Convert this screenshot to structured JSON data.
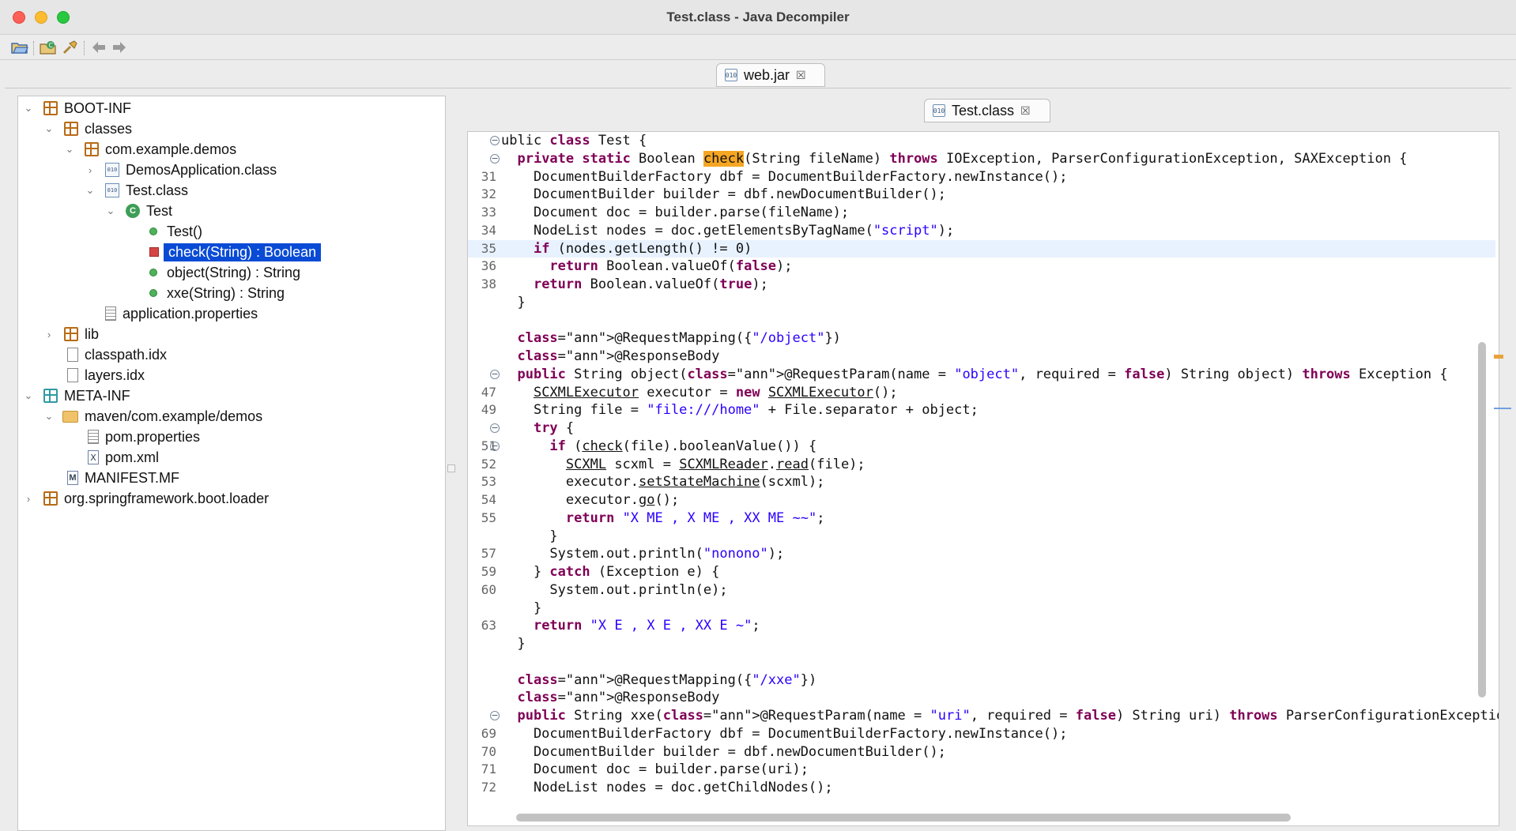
{
  "window": {
    "title": "Test.class - Java Decompiler",
    "colors": {
      "selection": "#0a4bd6",
      "keyword": "#7f0055",
      "string": "#2a00ff",
      "annotation": "#646464",
      "highlight": "#f5a623"
    }
  },
  "toolbar": {
    "icons": [
      "open-file-icon",
      "open-type-icon",
      "search-icon",
      "back-arrow-icon",
      "forward-arrow-icon"
    ]
  },
  "jar_tab": {
    "label": "web.jar",
    "close": "☒"
  },
  "class_tab": {
    "label": "Test.class",
    "close": "☒"
  },
  "tree": {
    "boot_inf": "BOOT-INF",
    "classes": "classes",
    "com_example_demos": "com.example.demos",
    "demos_application": "DemosApplication.class",
    "test_class": "Test.class",
    "test_type": "Test",
    "m_ctor": "Test()",
    "m_check": "check(String) : Boolean",
    "m_object": "object(String) : String",
    "m_xxe": "xxe(String) : String",
    "app_props": "application.properties",
    "lib": "lib",
    "classpath_idx": "classpath.idx",
    "layers_idx": "layers.idx",
    "meta_inf": "META-INF",
    "maven": "maven/com.example/demos",
    "pom_props": "pom.properties",
    "pom_xml": "pom.xml",
    "manifest": "MANIFEST.MF",
    "loader": "org.springframework.boot.loader"
  },
  "code": {
    "lines": [
      {
        "num": "",
        "fold": "⊖",
        "text": "ublic class Test {"
      },
      {
        "num": "",
        "fold": "⊖",
        "text": "  private static Boolean check(String fileName) throws IOException, ParserConfigurationException, SAXException {"
      },
      {
        "num": "31",
        "fold": "",
        "text": "    DocumentBuilderFactory dbf = DocumentBuilderFactory.newInstance();"
      },
      {
        "num": "32",
        "fold": "",
        "text": "    DocumentBuilder builder = dbf.newDocumentBuilder();"
      },
      {
        "num": "33",
        "fold": "",
        "text": "    Document doc = builder.parse(fileName);"
      },
      {
        "num": "34",
        "fold": "",
        "text": "    NodeList nodes = doc.getElementsByTagName(\"script\");"
      },
      {
        "num": "35",
        "fold": "",
        "text": "    if (nodes.getLength() != 0)"
      },
      {
        "num": "36",
        "fold": "",
        "text": "      return Boolean.valueOf(false);"
      },
      {
        "num": "38",
        "fold": "",
        "text": "    return Boolean.valueOf(true);"
      },
      {
        "num": "",
        "fold": "",
        "text": "  }"
      },
      {
        "num": "",
        "fold": "",
        "text": ""
      },
      {
        "num": "",
        "fold": "",
        "text": "  @RequestMapping({\"/object\"})"
      },
      {
        "num": "",
        "fold": "",
        "text": "  @ResponseBody"
      },
      {
        "num": "",
        "fold": "⊖",
        "text": "  public String object(@RequestParam(name = \"object\", required = false) String object) throws Exception {"
      },
      {
        "num": "47",
        "fold": "",
        "text": "    SCXMLExecutor executor = new SCXMLExecutor();"
      },
      {
        "num": "49",
        "fold": "",
        "text": "    String file = \"file:///home\" + File.separator + object;"
      },
      {
        "num": "",
        "fold": "⊖",
        "text": "    try {"
      },
      {
        "num": "51",
        "fold": "⊖",
        "text": "      if (check(file).booleanValue()) {"
      },
      {
        "num": "52",
        "fold": "",
        "text": "        SCXML scxml = SCXMLReader.read(file);"
      },
      {
        "num": "53",
        "fold": "",
        "text": "        executor.setStateMachine(scxml);"
      },
      {
        "num": "54",
        "fold": "",
        "text": "        executor.go();"
      },
      {
        "num": "55",
        "fold": "",
        "text": "        return \"X ME , X ME , XX ME ~~\";"
      },
      {
        "num": "",
        "fold": "",
        "text": "      }"
      },
      {
        "num": "57",
        "fold": "",
        "text": "      System.out.println(\"nonono\");"
      },
      {
        "num": "59",
        "fold": "",
        "text": "    } catch (Exception e) {"
      },
      {
        "num": "60",
        "fold": "",
        "text": "      System.out.println(e);"
      },
      {
        "num": "",
        "fold": "",
        "text": "    }"
      },
      {
        "num": "63",
        "fold": "",
        "text": "    return \"X E , X E , XX E ~\";"
      },
      {
        "num": "",
        "fold": "",
        "text": "  }"
      },
      {
        "num": "",
        "fold": "",
        "text": ""
      },
      {
        "num": "",
        "fold": "",
        "text": "  @RequestMapping({\"/xxe\"})"
      },
      {
        "num": "",
        "fold": "",
        "text": "  @ResponseBody"
      },
      {
        "num": "",
        "fold": "⊖",
        "text": "  public String xxe(@RequestParam(name = \"uri\", required = false) String uri) throws ParserConfigurationException,"
      },
      {
        "num": "69",
        "fold": "",
        "text": "    DocumentBuilderFactory dbf = DocumentBuilderFactory.newInstance();"
      },
      {
        "num": "70",
        "fold": "",
        "text": "    DocumentBuilder builder = dbf.newDocumentBuilder();"
      },
      {
        "num": "71",
        "fold": "",
        "text": "    Document doc = builder.parse(uri);"
      },
      {
        "num": "72",
        "fold": "",
        "text": "    NodeList nodes = doc.getChildNodes();"
      }
    ]
  }
}
